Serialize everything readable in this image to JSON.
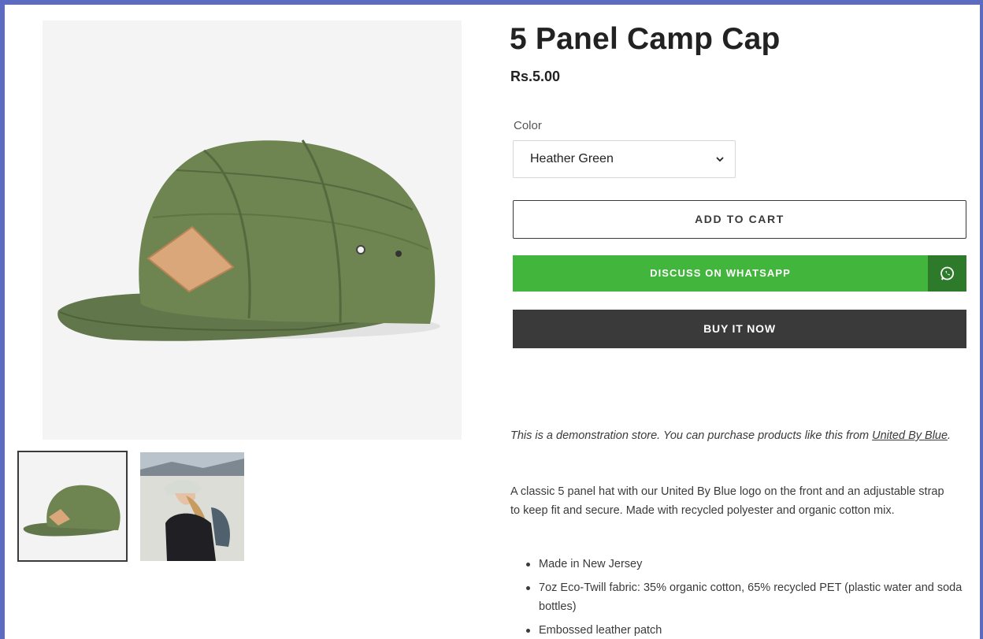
{
  "product": {
    "title": "5 Panel Camp Cap",
    "price": "Rs.5.00",
    "color_label": "Color",
    "color_selected": "Heather Green",
    "add_to_cart": "ADD TO CART",
    "whatsapp_label": "DISCUSS ON WHATSAPP",
    "buy_now": "BUY IT NOW",
    "demo_note_text": "This is a demonstration store. You can purchase products like this from ",
    "demo_note_link": "United By Blue",
    "demo_note_end": ".",
    "description": "A classic 5 panel hat with our United By Blue logo on the front and an adjustable strap to keep fit and secure. Made with recycled polyester and organic cotton mix.",
    "features": [
      "Made in New Jersey",
      "7oz Eco-Twill fabric: 35% organic cotton, 65% recycled PET (plastic water and soda bottles)",
      "Embossed leather patch"
    ]
  },
  "colors": {
    "whatsapp_green": "#42b53d",
    "whatsapp_icon_bg": "#2d7a2b",
    "buy_now_bg": "#3a3a3a",
    "cap_green": "#6e8451",
    "patch": "#d9a77a",
    "frame": "#5c6bc0"
  },
  "icons": {
    "select": "chevron-down-icon",
    "whatsapp": "whatsapp-icon"
  }
}
